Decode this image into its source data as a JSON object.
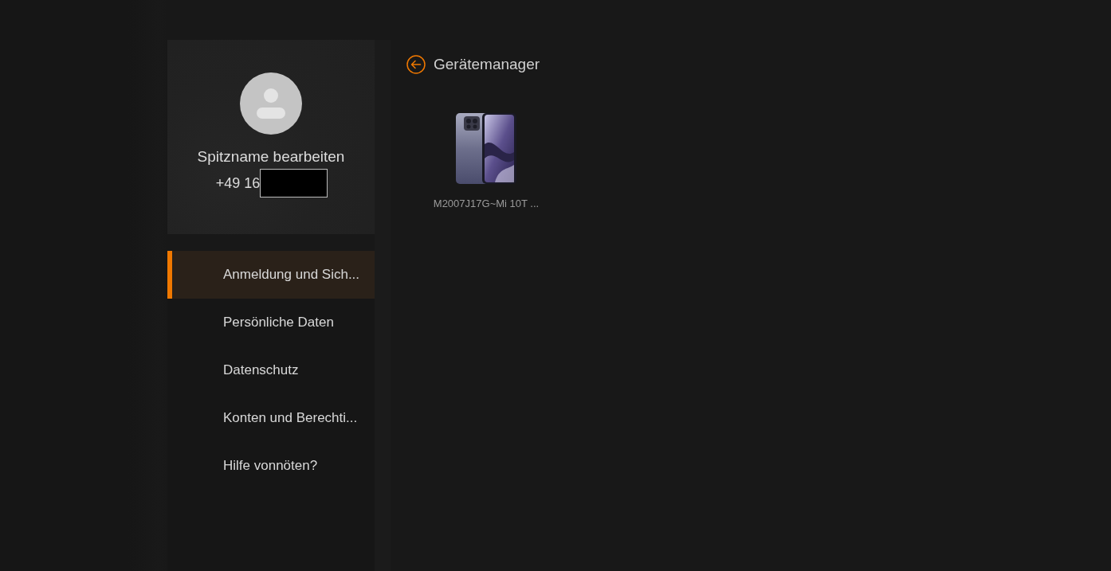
{
  "profile": {
    "nickname_link": "Spitzname bearbeiten",
    "phone": {
      "text": "+49 16",
      "redacted": true
    }
  },
  "menu": [
    {
      "label": "Anmeldung und Sich...",
      "selected": true
    },
    {
      "label": "Persönliche Daten",
      "selected": false
    },
    {
      "label": "Datenschutz",
      "selected": false
    },
    {
      "label": "Konten und Berechti...",
      "selected": false
    },
    {
      "label": "Hilfe vonnöten?",
      "selected": false
    }
  ],
  "header": {
    "title": "Gerätemanager"
  },
  "devices": [
    {
      "name": "M2007J17G~Mi 10T ..."
    }
  ]
}
